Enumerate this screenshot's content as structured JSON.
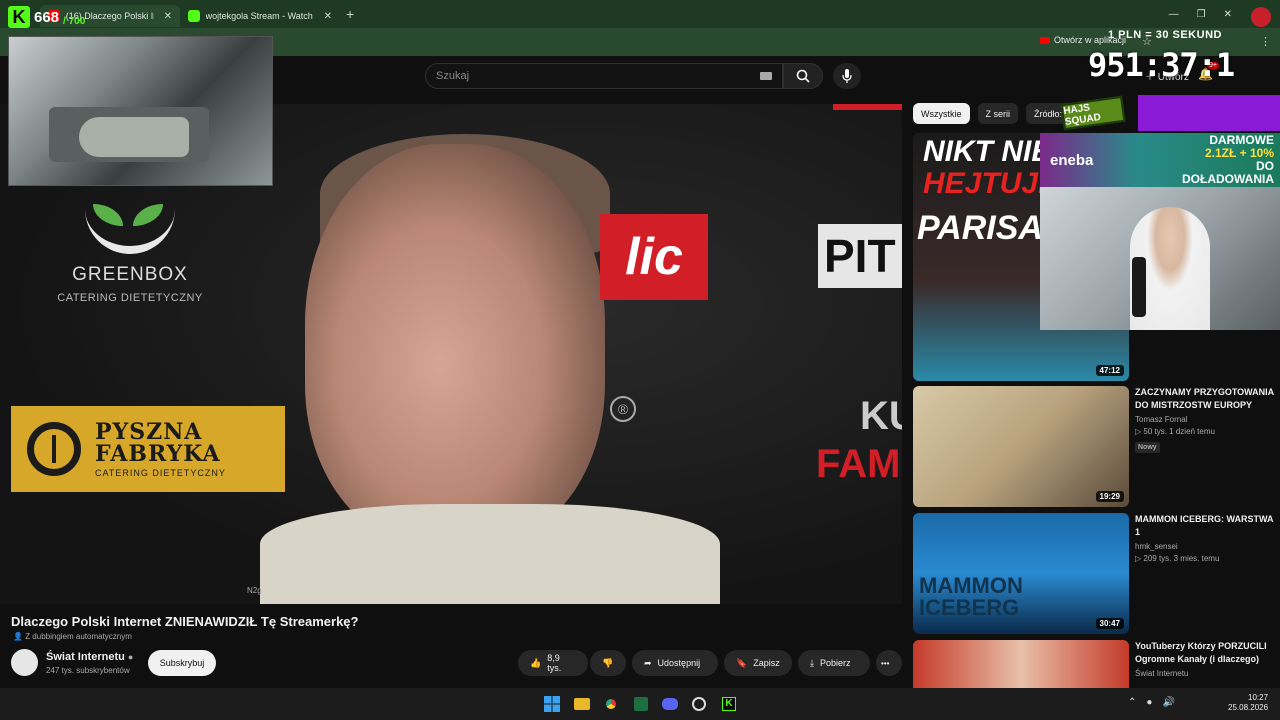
{
  "browser": {
    "tabs": [
      {
        "label": "(16) Dlaczego Polski Interne",
        "active": true,
        "favicon_color": "#ff0000"
      },
      {
        "label": "wojtekgola Stream - Watch Liv",
        "active": false,
        "favicon_color": "#53fc18"
      }
    ],
    "new_tab": "+",
    "window_controls": [
      "—",
      "❐",
      "✕"
    ],
    "open_in_app": "Otwórz w aplikacji"
  },
  "overlay": {
    "counter_value": "668",
    "counter_max": "/ 700",
    "rate_text": "1 PLN = 30 SEKUND",
    "timer": "951:37:1",
    "chip_badge": "HAJS SQUAD",
    "eneba_brand": "eneba",
    "eneba_promo_line1": "DARMOWE",
    "eneba_promo_line2": "2.1ZŁ + 10%",
    "eneba_promo_line3": "DO DOŁADOWANIA"
  },
  "youtube": {
    "search_placeholder": "Szukaj",
    "video": {
      "sponsor1_line1": "GREENBOX",
      "sponsor1_line2": "CATERING DIETETYCZNY",
      "sponsor2_line1": "PYSZNA",
      "sponsor2_line2": "FABRYKA",
      "sponsor2_line3": "CATERING DIETETYCZNY",
      "sponsor3": "lic",
      "sponsor4": "PIT",
      "sponsor5_line1": "KU",
      "sponsor5_line2": "FAM",
      "watermark": "N2g",
      "reg_mark": "®"
    },
    "title": "Dlaczego Polski Internet ZNIENAWIDZIŁ Tę Streamerkę?",
    "dubbing": "Z dubbingiem automatycznym",
    "channel": {
      "name": "Świat Internetu",
      "subscribers": "247 tys. subskrybentów",
      "subscribe_label": "Subskrybuj"
    },
    "actions": {
      "likes": "8,9 tys.",
      "share": "Udostępnij",
      "save": "Zapisz",
      "download": "Pobierz",
      "more": "•••"
    },
    "chips": [
      "Wszystkie",
      "Z serii",
      "Źródło: Ś"
    ],
    "recommended": [
      {
        "thumb_text1": "NIKT NIE",
        "thumb_text2": "HEJTUJE",
        "thumb_text3": "PARISA",
        "duration": "47:12",
        "title": "",
        "author": "",
        "views": "",
        "badge": ""
      },
      {
        "duration": "19:29",
        "title": "ZACZYNAMY PRZYGOTOWANIA DO MISTRZOSTW EUROPY",
        "author": "Tomasz Fornal",
        "views": "▷ 50 tys.  1 dzień temu",
        "badge": "Nowy"
      },
      {
        "thumb_text1": "MAMMON",
        "thumb_text2": "ICEBERG",
        "duration": "30:47",
        "title": "MAMMON ICEBERG: WARSTWA 1",
        "author": "hmk_sensei",
        "views": "▷ 209 tys.  3 mies. temu",
        "badge": ""
      },
      {
        "duration": "",
        "title": "YouTuberzy Którzy PORZUCILI Ogromne Kanały (i dlaczego)",
        "author": "Świat Internetu",
        "views": "",
        "badge": ""
      }
    ],
    "notification_badge": "9+"
  },
  "taskbar": {
    "time": "10:27",
    "date": "25.08.2026"
  },
  "colors": {
    "chrome_green": "#1e3a23",
    "kick_green": "#53fc18",
    "yt_bg": "#0f0f0f",
    "yt_red": "#ff0000",
    "pyszna_yellow": "#d7a72a"
  }
}
